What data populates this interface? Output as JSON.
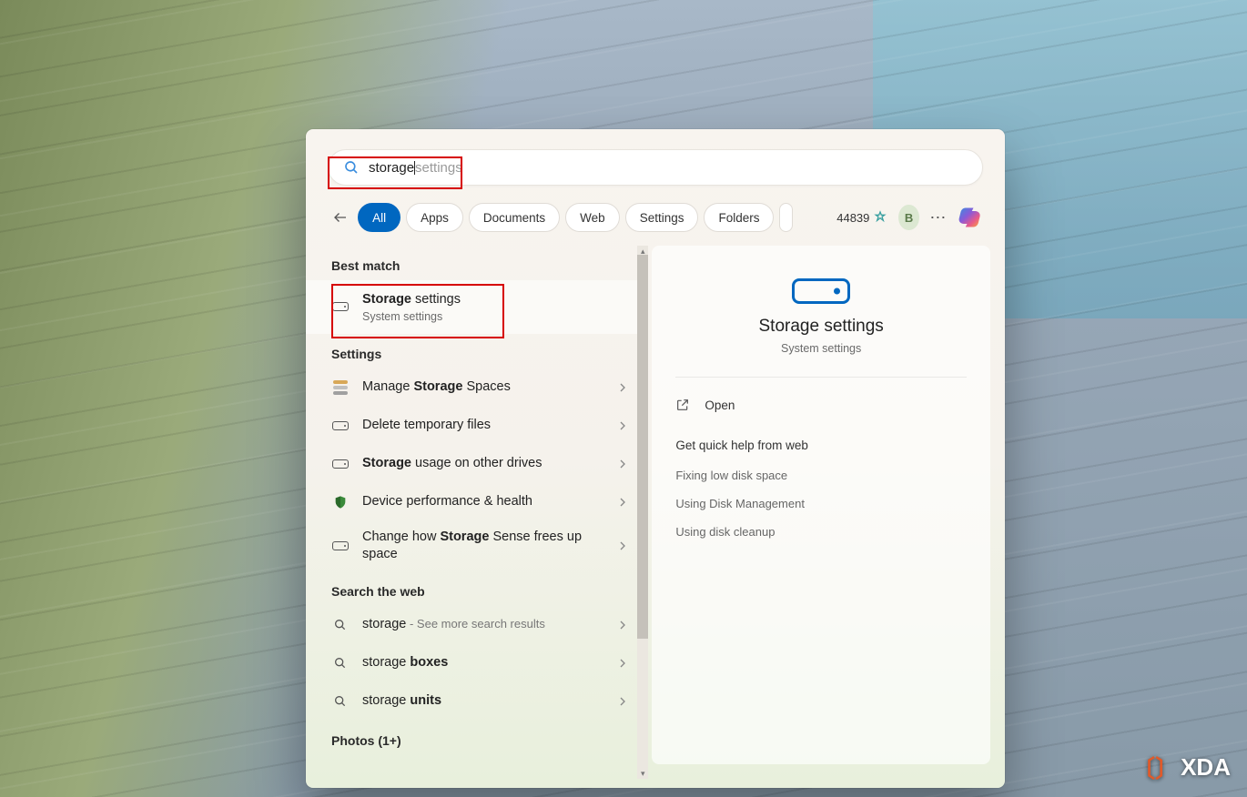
{
  "search": {
    "typed": "storage",
    "suggested_suffix": " settings"
  },
  "tabs": {
    "all": "All",
    "apps": "Apps",
    "documents": "Documents",
    "web": "Web",
    "settings": "Settings",
    "folders": "Folders"
  },
  "toolbar": {
    "points": "44839",
    "avatar_initial": "B"
  },
  "sections": {
    "best_match": "Best match",
    "settings": "Settings",
    "search_web": "Search the web",
    "photos": "Photos (1+)"
  },
  "results": {
    "best": {
      "title_bold": "Storage",
      "title_rest": " settings",
      "subtitle": "System settings"
    },
    "settings_items": [
      {
        "pre": "Manage ",
        "bold": "Storage",
        "post": " Spaces",
        "icon": "disks"
      },
      {
        "pre": "Delete temporary files",
        "bold": "",
        "post": "",
        "icon": "drive"
      },
      {
        "pre": "",
        "bold": "Storage",
        "post": " usage on other drives",
        "icon": "drive"
      },
      {
        "pre": "Device performance & health",
        "bold": "",
        "post": "",
        "icon": "shield"
      },
      {
        "pre": "Change how ",
        "bold": "Storage",
        "post": " Sense frees up space",
        "icon": "drive"
      }
    ],
    "web_items": [
      {
        "pre": "storage",
        "secondary": " - See more search results"
      },
      {
        "pre": "storage ",
        "bold": "boxes"
      },
      {
        "pre": "storage ",
        "bold": "units"
      }
    ]
  },
  "preview": {
    "title": "Storage settings",
    "subtitle": "System settings",
    "open_label": "Open",
    "help_title": "Get quick help from web",
    "help_links": [
      "Fixing low disk space",
      "Using Disk Management",
      "Using disk cleanup"
    ]
  },
  "watermark": "XDA"
}
